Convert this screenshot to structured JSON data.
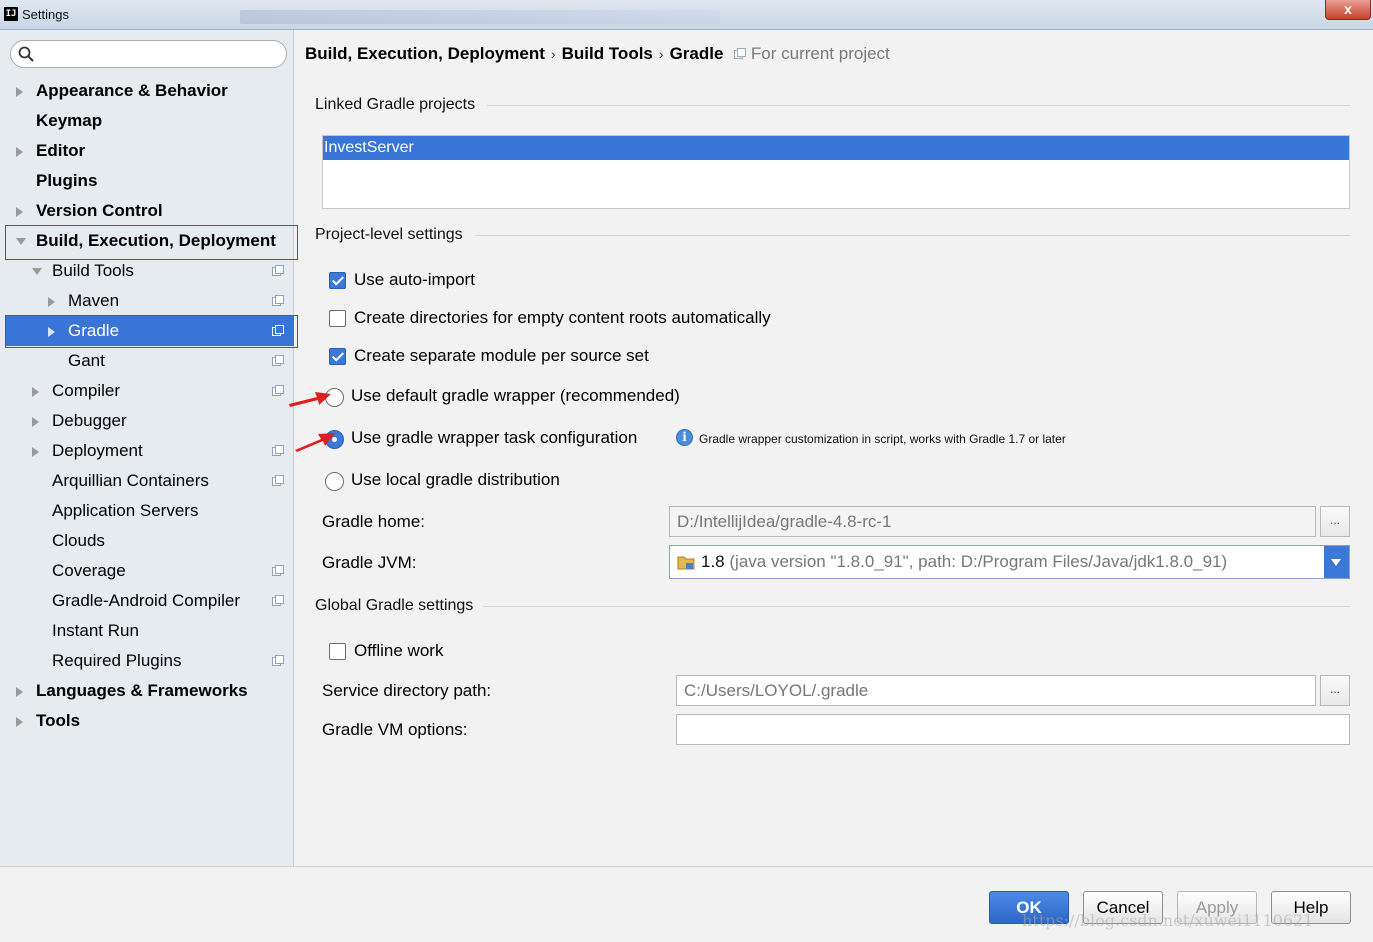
{
  "window": {
    "title": "Settings",
    "app_icon_text": "IJ",
    "close_label": "x"
  },
  "search": {
    "placeholder": ""
  },
  "sidebar": {
    "items": [
      {
        "label": "Appearance & Behavior",
        "level": 0,
        "bold": true,
        "arrow": "right"
      },
      {
        "label": "Keymap",
        "level": 0,
        "bold": true,
        "arrow": ""
      },
      {
        "label": "Editor",
        "level": 0,
        "bold": true,
        "arrow": "right"
      },
      {
        "label": "Plugins",
        "level": 0,
        "bold": true,
        "arrow": ""
      },
      {
        "label": "Version Control",
        "level": 0,
        "bold": true,
        "arrow": "right"
      },
      {
        "label": "Build, Execution, Deployment",
        "level": 0,
        "bold": true,
        "arrow": "down"
      },
      {
        "label": "Build Tools",
        "level": 1,
        "bold": false,
        "arrow": "down",
        "project": true
      },
      {
        "label": "Maven",
        "level": 2,
        "bold": false,
        "arrow": "right",
        "project": true
      },
      {
        "label": "Gradle",
        "level": 2,
        "bold": false,
        "arrow": "right",
        "project": true,
        "selected": true
      },
      {
        "label": "Gant",
        "level": 2,
        "bold": false,
        "arrow": "",
        "project": true
      },
      {
        "label": "Compiler",
        "level": 1,
        "bold": false,
        "arrow": "right",
        "project": true
      },
      {
        "label": "Debugger",
        "level": 1,
        "bold": false,
        "arrow": "right"
      },
      {
        "label": "Deployment",
        "level": 1,
        "bold": false,
        "arrow": "right",
        "project": true
      },
      {
        "label": "Arquillian Containers",
        "level": 1,
        "bold": false,
        "arrow": "",
        "project": true
      },
      {
        "label": "Application Servers",
        "level": 1,
        "bold": false,
        "arrow": ""
      },
      {
        "label": "Clouds",
        "level": 1,
        "bold": false,
        "arrow": ""
      },
      {
        "label": "Coverage",
        "level": 1,
        "bold": false,
        "arrow": "",
        "project": true
      },
      {
        "label": "Gradle-Android Compiler",
        "level": 1,
        "bold": false,
        "arrow": "",
        "project": true
      },
      {
        "label": "Instant Run",
        "level": 1,
        "bold": false,
        "arrow": ""
      },
      {
        "label": "Required Plugins",
        "level": 1,
        "bold": false,
        "arrow": "",
        "project": true
      },
      {
        "label": "Languages & Frameworks",
        "level": 0,
        "bold": true,
        "arrow": "right"
      },
      {
        "label": "Tools",
        "level": 0,
        "bold": true,
        "arrow": "right"
      }
    ]
  },
  "breadcrumb": {
    "parts": [
      "Build, Execution, Deployment",
      "Build Tools",
      "Gradle"
    ],
    "separator": "›",
    "scope": "For current project"
  },
  "linked": {
    "title": "Linked Gradle projects",
    "projects": [
      "InvestServer"
    ]
  },
  "project_settings": {
    "title": "Project-level settings",
    "auto_import": {
      "label": "Use auto-import",
      "checked": true
    },
    "create_dirs": {
      "label": "Create directories for empty content roots automatically",
      "checked": false
    },
    "separate_module": {
      "label": "Create separate module per source set",
      "checked": true
    },
    "wrapper_default": {
      "label": "Use default gradle wrapper (recommended)",
      "selected": false
    },
    "wrapper_task": {
      "label": "Use gradle wrapper task configuration",
      "selected": true
    },
    "wrapper_info": "Gradle wrapper customization in script, works with Gradle 1.7 or later",
    "local_dist": {
      "label": "Use local gradle distribution",
      "selected": false
    },
    "gradle_home_label": "Gradle home:",
    "gradle_home_value": "D:/IntellijIdea/gradle-4.8-rc-1",
    "gradle_jvm_label": "Gradle JVM:",
    "gradle_jvm_version": "1.8",
    "gradle_jvm_detail": "(java version \"1.8.0_91\", path: D:/Program Files/Java/jdk1.8.0_91)",
    "browse_label": "..."
  },
  "global_settings": {
    "title": "Global Gradle settings",
    "offline": {
      "label": "Offline work",
      "checked": false
    },
    "service_dir_label": "Service directory path:",
    "service_dir_value": "C:/Users/LOYOL/.gradle",
    "vm_options_label": "Gradle VM options:",
    "vm_options_value": ""
  },
  "footer": {
    "ok": "OK",
    "cancel": "Cancel",
    "apply": "Apply",
    "help": "Help",
    "watermark": "https://blog.csdn.net/xuwei1110621"
  },
  "colors": {
    "accent": "#3875d7",
    "highlight_box": "#e02020",
    "annotation_arrow": "#e02020"
  }
}
